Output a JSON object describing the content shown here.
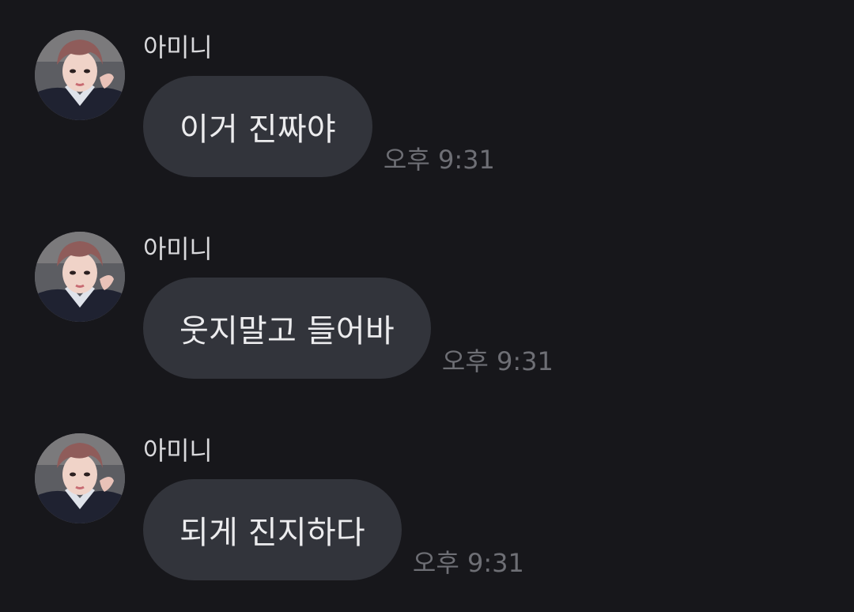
{
  "conversation": {
    "messages": [
      {
        "sender": "아미니",
        "text": "이거 진짜야",
        "time": "오후 9:31",
        "avatar": "profile-photo"
      },
      {
        "sender": "아미니",
        "text": "웃지말고 들어바",
        "time": "오후 9:31",
        "avatar": "profile-photo"
      },
      {
        "sender": "아미니",
        "text": "되게 진지하다",
        "time": "오후 9:31",
        "avatar": "profile-photo"
      }
    ]
  },
  "colors": {
    "background": "#17171b",
    "bubble": "#32343b",
    "text": "#ececee",
    "timestamp": "#6e6f75"
  }
}
